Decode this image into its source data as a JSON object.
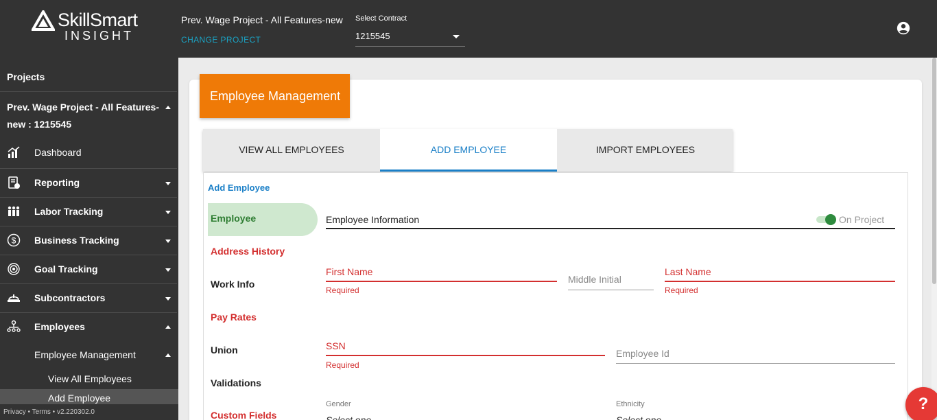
{
  "app": {
    "brand": "SkillSmart",
    "brand_sub": "INSIGHT"
  },
  "header": {
    "project_name": "Prev. Wage Project - All Features-new",
    "change_project": "CHANGE PROJECT",
    "contract_label": "Select Contract",
    "contract_value": "1215545"
  },
  "sidebar": {
    "projects_label": "Projects",
    "project_line1": "Prev. Wage Project - All Features-",
    "project_line2": "new : 1215545",
    "items": [
      {
        "label": "Dashboard",
        "icon": "dashboard-chart-icon"
      },
      {
        "label": "Reporting",
        "icon": "report-icon"
      },
      {
        "label": "Labor Tracking",
        "icon": "workers-icon"
      },
      {
        "label": "Business Tracking",
        "icon": "dollar-icon"
      },
      {
        "label": "Goal Tracking",
        "icon": "target-icon"
      },
      {
        "label": "Subcontractors",
        "icon": "hardhat-icon"
      },
      {
        "label": "Employees",
        "icon": "org-chart-icon"
      }
    ],
    "sub_menu": "Employee Management",
    "sub_items": [
      "View All Employees",
      "Add Employee"
    ],
    "footer": "Privacy • Terms • v2.220302.0"
  },
  "page": {
    "title": "Employee Management",
    "tabs": [
      "VIEW ALL EMPLOYEES",
      "ADD EMPLOYEE",
      "IMPORT EMPLOYEES"
    ],
    "form_heading": "Add Employee",
    "steps": [
      "Employee",
      "Address History",
      "Work Info",
      "Pay Rates",
      "Union",
      "Validations",
      "Custom Fields"
    ],
    "section_title": "Employee Information",
    "toggle_label": "On Project",
    "fields": {
      "first_name": "First Name",
      "middle_initial": "Middle Initial",
      "last_name": "Last Name",
      "ssn": "SSN",
      "employee_id": "Employee Id",
      "required": "Required",
      "gender": "Gender",
      "ethnicity": "Ethnicity",
      "select_one": "Select one"
    },
    "help": "?"
  },
  "colors": {
    "topbar": "#333333",
    "accent_orange": "#ef7a07",
    "accent_blue": "#1a7fc7",
    "error_red": "#d32f2f",
    "success_green": "#2e8b3e"
  }
}
